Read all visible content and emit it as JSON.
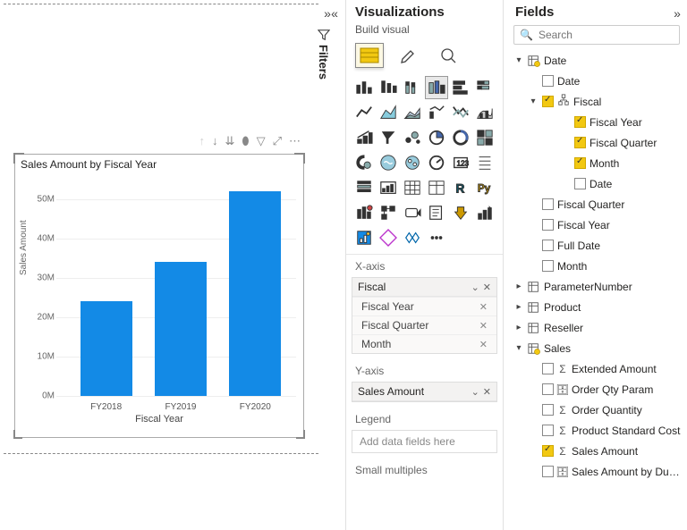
{
  "panels": {
    "filters_label": "Filters",
    "visualizations_title": "Visualizations",
    "build_visual_label": "Build visual",
    "fields_title": "Fields",
    "search_placeholder": "Search"
  },
  "chart_actions": [
    "↑",
    "↓",
    "↓↓",
    "⬚",
    "▽",
    "⤢",
    "⋯"
  ],
  "field_wells": {
    "xaxis_label": "X-axis",
    "xaxis_group": "Fiscal",
    "xaxis_items": [
      "Fiscal Year",
      "Fiscal Quarter",
      "Month"
    ],
    "yaxis_label": "Y-axis",
    "yaxis_item": "Sales Amount",
    "legend_label": "Legend",
    "legend_placeholder": "Add data fields here",
    "small_multiples_label": "Small multiples"
  },
  "tables": {
    "date": {
      "name": "Date",
      "fields_plain": [
        "Date"
      ],
      "fiscal": {
        "name": "Fiscal",
        "children": [
          "Fiscal Year",
          "Fiscal Quarter",
          "Month",
          "Date"
        ],
        "checked": [
          true,
          true,
          true,
          false
        ]
      },
      "post_fiscal": [
        "Fiscal Quarter",
        "Fiscal Year",
        "Full Date",
        "Month"
      ]
    },
    "parameter": {
      "name": "ParameterNumber"
    },
    "product": {
      "name": "Product"
    },
    "reseller": {
      "name": "Reseller"
    },
    "sales": {
      "name": "Sales",
      "fields": [
        {
          "label": "Extended Amount",
          "checked": false,
          "icon": "sigma"
        },
        {
          "label": "Order Qty Param",
          "checked": false,
          "icon": "calc"
        },
        {
          "label": "Order Quantity",
          "checked": false,
          "icon": "sigma"
        },
        {
          "label": "Product Standard Cost",
          "checked": false,
          "icon": "sigma"
        },
        {
          "label": "Sales Amount",
          "checked": true,
          "icon": "sigma"
        },
        {
          "label": "Sales Amount by Du…",
          "checked": false,
          "icon": "calc"
        }
      ]
    }
  },
  "chart_data": {
    "type": "bar",
    "title": "Sales Amount by Fiscal Year",
    "xlabel": "Fiscal Year",
    "ylabel": "Sales Amount",
    "categories": [
      "FY2018",
      "FY2019",
      "FY2020"
    ],
    "values": [
      24000000,
      34000000,
      52000000
    ],
    "ylim": [
      0,
      55000000
    ],
    "yticks": [
      0,
      10000000,
      20000000,
      30000000,
      40000000,
      50000000
    ],
    "ytick_labels": [
      "0M",
      "10M",
      "20M",
      "30M",
      "40M",
      "50M"
    ]
  }
}
